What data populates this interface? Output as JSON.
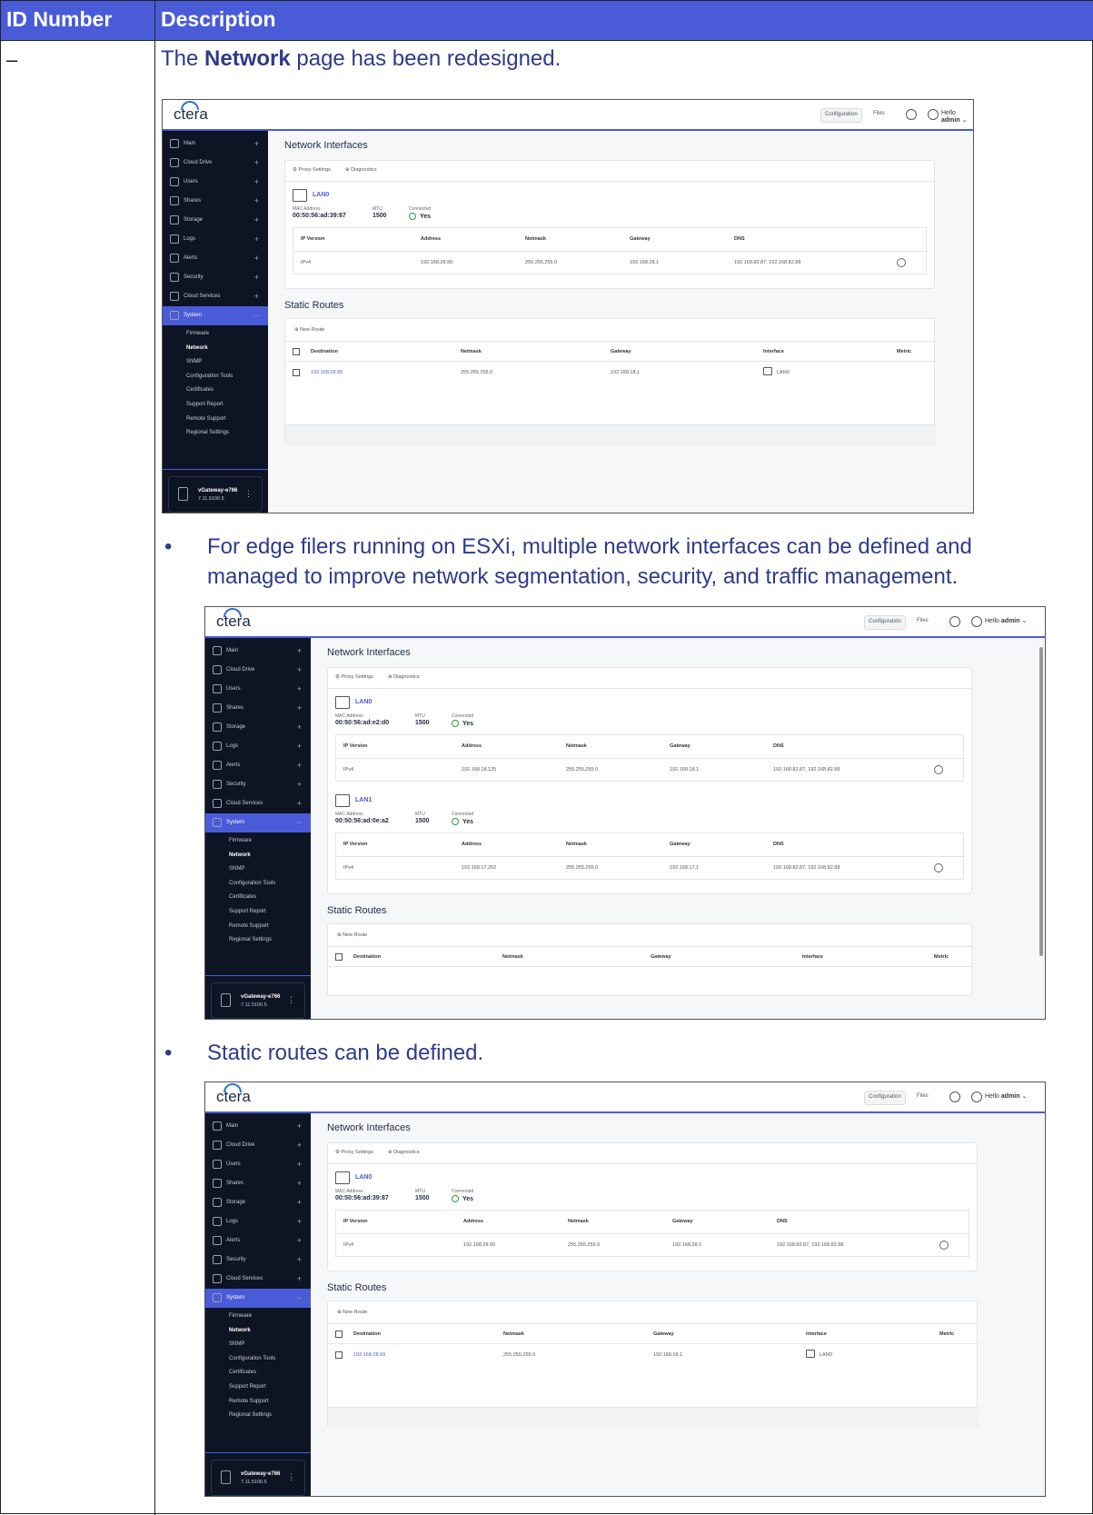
{
  "doc": {
    "col_id": "ID Number",
    "col_desc": "Description",
    "id_value": "–",
    "intro_pre": "The ",
    "intro_bold": "Network",
    "intro_post": " page has been redesigned.",
    "bullet1": "For edge filers running on ESXi, multiple network interfaces can be defined and",
    "bullet1b": "managed to improve network segmentation, security, and traffic management.",
    "bullet2": "Static routes can be defined.",
    "bullet_glyph": "•"
  },
  "ui": {
    "logo": "ctera",
    "configuration": "Configuration",
    "files": "Files",
    "hello": "Hello",
    "user": "admin",
    "nav": [
      "Main",
      "Cloud Drive",
      "Users",
      "Shares",
      "Storage",
      "Logs",
      "Alerts",
      "Security",
      "Cloud Services",
      "System"
    ],
    "plus": "+",
    "minus": "−",
    "sub": [
      "Firmware",
      "Network",
      "SNMP",
      "Configuration Tools",
      "Certificates",
      "Support Report",
      "Remote Support",
      "Regional Settings"
    ],
    "gateway_name": "vGateway-e766",
    "gateway_version": "7.11.5100.5",
    "dots": "⋮",
    "ni_title": "Network Interfaces",
    "proxy": "Proxy Settings",
    "diagnostics": "Diagnostics",
    "mac_label": "MAC Address",
    "mtu_label": "MTU",
    "connected_label": "Connected",
    "yes": "Yes",
    "ip_headers": [
      "IP Version",
      "Address",
      "Netmask",
      "Gateway",
      "DNS"
    ],
    "ipv4": "IPv4",
    "dns": "192.168.82.87, 192.168.82.88",
    "sr_title": "Static Routes",
    "new_route": "New Route",
    "sr_headers": [
      "Destination",
      "Netmask",
      "Gateway",
      "Interface",
      "Metric"
    ],
    "route": {
      "dest": "192.168.28.99",
      "mask": "255.255.255.0",
      "gw": "192.168.18.1",
      "iface": "LAN0"
    }
  },
  "s1": {
    "lan": "LAN0",
    "mac": "00:50:56:ad:39:87",
    "mtu": "1500",
    "addr": "192.168.28.90",
    "mask": "255.255.255.0",
    "gw": "192.168.28.1"
  },
  "s2a": {
    "lan": "LAN0",
    "mac": "00:50:56:ad:e2:d0",
    "mtu": "1500",
    "addr": "192.168.18.125",
    "mask": "255.255.255.0",
    "gw": "192.168.18.1"
  },
  "s2b": {
    "lan": "LAN1",
    "mac": "00:50:56:ad:0e:a2",
    "mtu": "1500",
    "addr": "192.168.17.202",
    "mask": "255.255.255.0",
    "gw": "192.168.17.1"
  }
}
